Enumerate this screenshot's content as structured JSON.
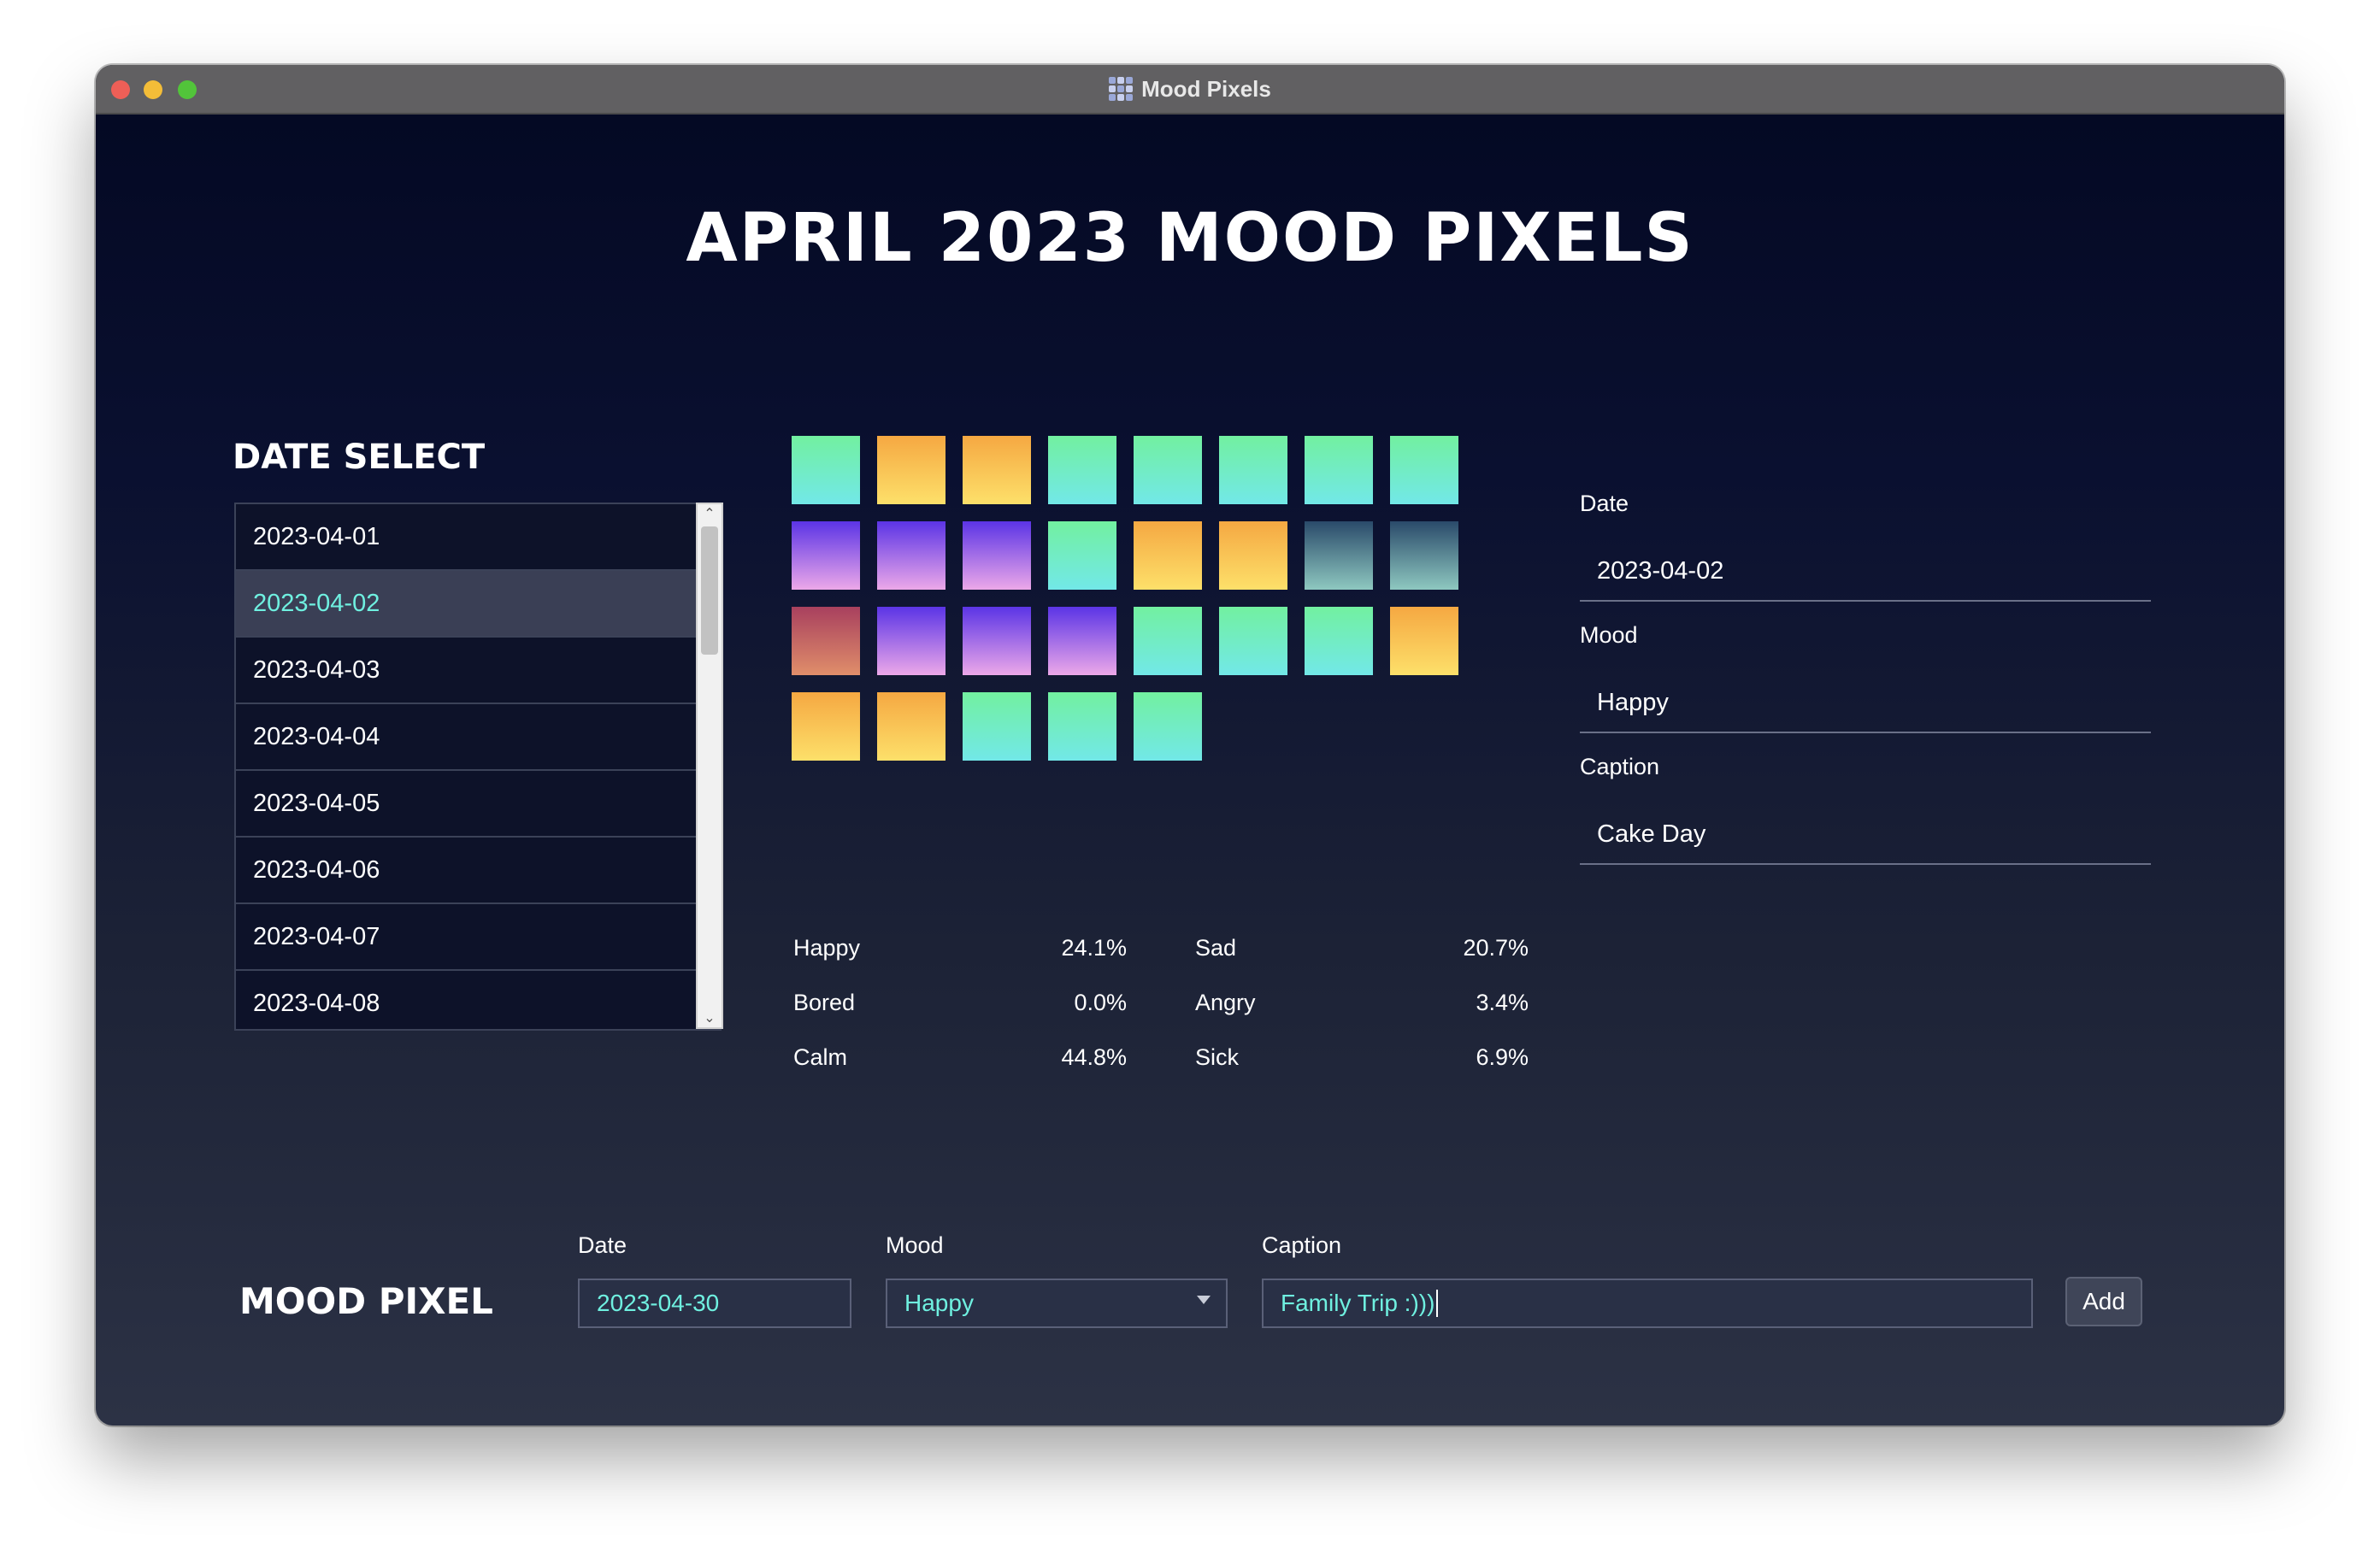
{
  "window": {
    "title": "Mood Pixels"
  },
  "header": {
    "title": "APRIL 2023 MOOD PIXELS"
  },
  "date_select": {
    "title": "DATE SELECT",
    "items": [
      "2023-04-01",
      "2023-04-02",
      "2023-04-03",
      "2023-04-04",
      "2023-04-05",
      "2023-04-06",
      "2023-04-07",
      "2023-04-08"
    ],
    "selected": "2023-04-02"
  },
  "mood_grid": {
    "days": [
      "calm",
      "happy",
      "happy",
      "calm",
      "calm",
      "calm",
      "calm",
      "calm",
      "sad",
      "sad",
      "sad",
      "calm",
      "happy",
      "happy",
      "sick",
      "sick",
      "angry",
      "sad",
      "sad",
      "sad",
      "calm",
      "calm",
      "calm",
      "happy",
      "happy",
      "happy",
      "calm",
      "calm",
      "calm"
    ]
  },
  "stats": [
    {
      "left_name": "Happy",
      "left_value": "24.1%",
      "right_name": "Sad",
      "right_value": "20.7%"
    },
    {
      "left_name": "Bored",
      "left_value": "0.0%",
      "right_name": "Angry",
      "right_value": "3.4%"
    },
    {
      "left_name": "Calm",
      "left_value": "44.8%",
      "right_name": "Sick",
      "right_value": "6.9%"
    }
  ],
  "details": {
    "date_label": "Date",
    "date_value": "2023-04-02",
    "mood_label": "Mood",
    "mood_value": "Happy",
    "caption_label": "Caption",
    "caption_value": "Cake Day"
  },
  "form": {
    "title": "MOOD PIXEL",
    "date_label": "Date",
    "date_value": "2023-04-30",
    "mood_label": "Mood",
    "mood_value": "Happy",
    "caption_label": "Caption",
    "caption_value": "Family Trip :)))",
    "add_label": "Add"
  },
  "colors": {
    "accent": "#6ff0e0",
    "happy": "#fbc84e",
    "calm": "#72f0c4",
    "sad": "#8a5aea",
    "sick": "#5a8a98",
    "angry": "#c0646a",
    "bored": "#aaaaaa"
  }
}
